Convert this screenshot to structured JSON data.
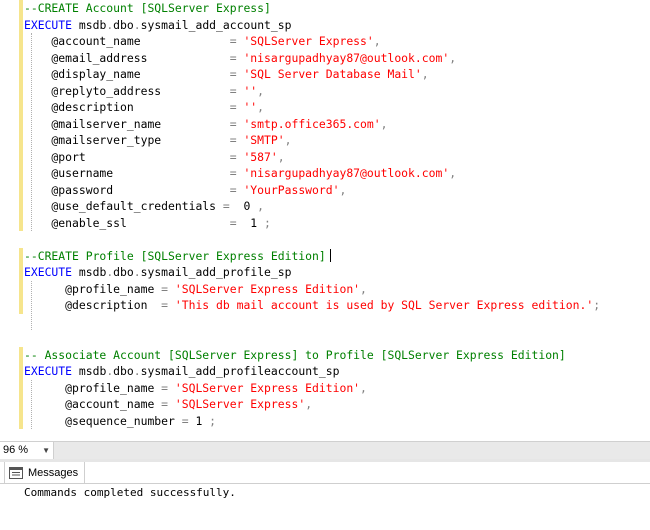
{
  "colors": {
    "keyword": "#0000ff",
    "comment": "#008000",
    "string": "#ff0000",
    "object": "#008080",
    "gray": "#808080",
    "text": "#000000",
    "change_bar": "#f6e58d"
  },
  "editor": {
    "lines": [
      [
        [
          "comment",
          "--CREATE Account [SQLServer Express]"
        ]
      ],
      [
        [
          "keyword",
          "EXECUTE"
        ],
        [
          "text",
          " msdb"
        ],
        [
          "gray",
          "."
        ],
        [
          "text",
          "dbo"
        ],
        [
          "gray",
          "."
        ],
        [
          "text",
          "sysmail_add_account_sp"
        ]
      ],
      [
        [
          "text",
          "    @account_name             "
        ],
        [
          "gray",
          "="
        ],
        [
          "text",
          " "
        ],
        [
          "string",
          "'SQLServer Express'"
        ],
        [
          "gray",
          ","
        ]
      ],
      [
        [
          "text",
          "    @email_address            "
        ],
        [
          "gray",
          "="
        ],
        [
          "text",
          " "
        ],
        [
          "string",
          "'nisargupadhyay87@outlook.com'"
        ],
        [
          "gray",
          ","
        ]
      ],
      [
        [
          "text",
          "    @display_name             "
        ],
        [
          "gray",
          "="
        ],
        [
          "text",
          " "
        ],
        [
          "string",
          "'SQL Server Database Mail'"
        ],
        [
          "gray",
          ","
        ]
      ],
      [
        [
          "text",
          "    @replyto_address          "
        ],
        [
          "gray",
          "="
        ],
        [
          "text",
          " "
        ],
        [
          "string",
          "''"
        ],
        [
          "gray",
          ","
        ]
      ],
      [
        [
          "text",
          "    @description              "
        ],
        [
          "gray",
          "="
        ],
        [
          "text",
          " "
        ],
        [
          "string",
          "''"
        ],
        [
          "gray",
          ","
        ]
      ],
      [
        [
          "text",
          "    @mailserver_name          "
        ],
        [
          "gray",
          "="
        ],
        [
          "text",
          " "
        ],
        [
          "string",
          "'smtp.office365.com'"
        ],
        [
          "gray",
          ","
        ]
      ],
      [
        [
          "text",
          "    @mailserver_type          "
        ],
        [
          "gray",
          "="
        ],
        [
          "text",
          " "
        ],
        [
          "string",
          "'SMTP'"
        ],
        [
          "gray",
          ","
        ]
      ],
      [
        [
          "text",
          "    @port                     "
        ],
        [
          "gray",
          "="
        ],
        [
          "text",
          " "
        ],
        [
          "string",
          "'587'"
        ],
        [
          "gray",
          ","
        ]
      ],
      [
        [
          "text",
          "    @username                 "
        ],
        [
          "gray",
          "="
        ],
        [
          "text",
          " "
        ],
        [
          "string",
          "'nisargupadhyay87@outlook.com'"
        ],
        [
          "gray",
          ","
        ]
      ],
      [
        [
          "text",
          "    @password                 "
        ],
        [
          "gray",
          "="
        ],
        [
          "text",
          " "
        ],
        [
          "string",
          "'YourPassword'"
        ],
        [
          "gray",
          ","
        ]
      ],
      [
        [
          "text",
          "    @use_default_credentials "
        ],
        [
          "gray",
          "="
        ],
        [
          "text",
          "  0 "
        ],
        [
          "gray",
          ","
        ]
      ],
      [
        [
          "text",
          "    @enable_ssl               "
        ],
        [
          "gray",
          "="
        ],
        [
          "text",
          "  1 "
        ],
        [
          "gray",
          ";"
        ]
      ],
      [],
      [
        [
          "comment",
          "--CREATE Profile [SQLServer Express Edition]"
        ]
      ],
      [
        [
          "keyword",
          "EXECUTE"
        ],
        [
          "text",
          " msdb"
        ],
        [
          "gray",
          "."
        ],
        [
          "text",
          "dbo"
        ],
        [
          "gray",
          "."
        ],
        [
          "text",
          "sysmail_add_profile_sp"
        ]
      ],
      [
        [
          "text",
          "      @profile_name "
        ],
        [
          "gray",
          "="
        ],
        [
          "text",
          " "
        ],
        [
          "string",
          "'SQLServer Express Edition'"
        ],
        [
          "gray",
          ","
        ]
      ],
      [
        [
          "text",
          "      @description  "
        ],
        [
          "gray",
          "="
        ],
        [
          "text",
          " "
        ],
        [
          "string",
          "'This db mail account is used by SQL Server Express edition.'"
        ],
        [
          "gray",
          ";"
        ]
      ],
      [],
      [],
      [
        [
          "comment",
          "-- Associate Account [SQLServer Express] to Profile [SQLServer Express Edition]"
        ]
      ],
      [
        [
          "keyword",
          "EXECUTE"
        ],
        [
          "text",
          " msdb"
        ],
        [
          "gray",
          "."
        ],
        [
          "text",
          "dbo"
        ],
        [
          "gray",
          "."
        ],
        [
          "text",
          "sysmail_add_profileaccount_sp"
        ]
      ],
      [
        [
          "text",
          "      @profile_name "
        ],
        [
          "gray",
          "="
        ],
        [
          "text",
          " "
        ],
        [
          "string",
          "'SQLServer Express Edition'"
        ],
        [
          "gray",
          ","
        ]
      ],
      [
        [
          "text",
          "      @account_name "
        ],
        [
          "gray",
          "="
        ],
        [
          "text",
          " "
        ],
        [
          "string",
          "'SQLServer Express'"
        ],
        [
          "gray",
          ","
        ]
      ],
      [
        [
          "text",
          "      @sequence_number "
        ],
        [
          "gray",
          "="
        ],
        [
          "text",
          " 1 "
        ],
        [
          "gray",
          ";"
        ]
      ]
    ]
  },
  "statusbar": {
    "zoom": "96 %"
  },
  "results": {
    "tab_label": "Messages",
    "message": "Commands completed successfully."
  }
}
